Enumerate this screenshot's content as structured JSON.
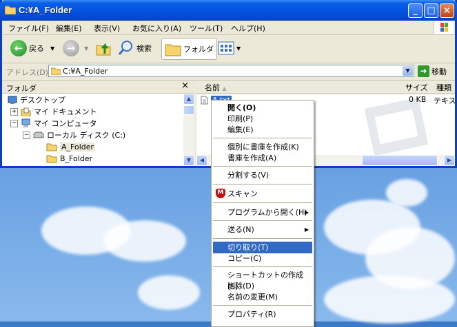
{
  "window": {
    "title": "C:¥A_Folder"
  },
  "menubar": {
    "items": [
      "ファイル(F)",
      "編集(E)",
      "表示(V)",
      "お気に入り(A)",
      "ツール(T)",
      "ヘルプ(H)"
    ]
  },
  "toolbar": {
    "back_label": "戻る",
    "search_label": "検索",
    "folders_label": "フォルダ"
  },
  "addressbar": {
    "label": "アドレス(D)",
    "value": "C:¥A_Folder",
    "go_label": "移動"
  },
  "folder_pane": {
    "title": "フォルダ",
    "close": "×",
    "tree": [
      {
        "label": "デスクトップ"
      },
      {
        "label": "マイ ドキュメント"
      },
      {
        "label": "マイ コンピュータ"
      },
      {
        "label": "ローカル ディスク (C:)"
      },
      {
        "label": "A_Folder"
      },
      {
        "label": "B_Folder"
      }
    ]
  },
  "file_pane": {
    "columns": {
      "name": "名前",
      "size": "サイズ",
      "type": "種類"
    },
    "file": {
      "name": "A.txt",
      "size": "0 KB",
      "type": "テキスト"
    }
  },
  "context_menu": {
    "items": [
      {
        "label": "開く(O)",
        "bold": true
      },
      {
        "label": "印刷(P)"
      },
      {
        "label": "編集(E)"
      },
      {
        "label": "個別に書庫を作成(K)"
      },
      {
        "label": "書庫を作成(A)"
      },
      {
        "label": "分割する(V)"
      },
      {
        "label": "スキャン"
      },
      {
        "label": "プログラムから開く(H)"
      },
      {
        "label": "送る(N)"
      },
      {
        "label": "切り取り(T)"
      },
      {
        "label": "コピー(C)"
      },
      {
        "label": "ショートカットの作成(S)"
      },
      {
        "label": "削除(D)"
      },
      {
        "label": "名前の変更(M)"
      },
      {
        "label": "プロパティ(R)"
      }
    ]
  },
  "colors": {
    "titlebar": "#0554e0",
    "selection": "#316ac5",
    "chrome": "#ece9d8"
  }
}
